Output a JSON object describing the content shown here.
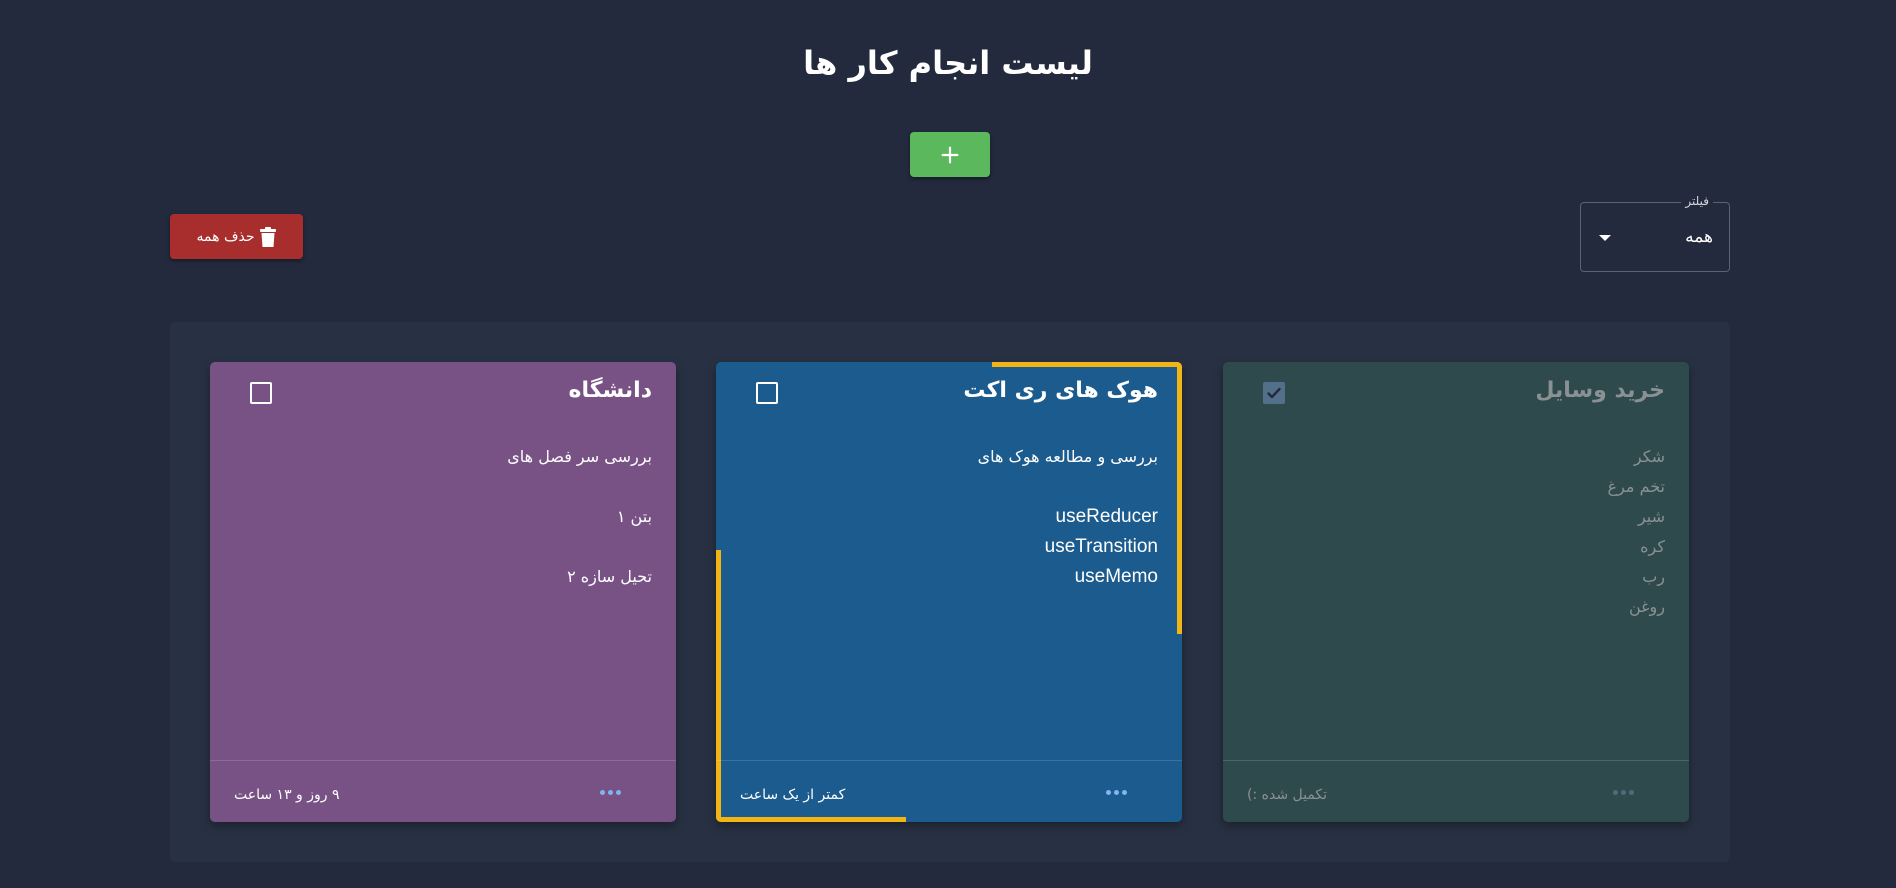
{
  "header": {
    "title": "لیست انجام کار ها",
    "add_icon": "plus-icon"
  },
  "filter": {
    "label": "فیلتر",
    "selected": "همه"
  },
  "toolbar": {
    "delete_all_label": "حذف همه",
    "delete_icon": "trash-icon"
  },
  "colors": {
    "background": "#232a3d",
    "board": "#283143",
    "add_button": "#5cb85c",
    "delete_button": "#a82d2d",
    "card_university": "#785285",
    "card_hooks": "#1b5b8e",
    "card_shopping": "#2f4a4c",
    "highlight": "#f3b416"
  },
  "cards": [
    {
      "title": "دانشگاه",
      "checked": false,
      "lines": [
        "بررسی سر فصل های",
        "",
        "بتن ۱",
        "",
        "تحیل سازه ۲"
      ],
      "footer": "۹ روز و ۱۳ ساعت"
    },
    {
      "title": "هوک های ری اکت",
      "checked": false,
      "lines": [
        "بررسی و مطالعه هوک های",
        "",
        "useReducer",
        "useTransition",
        "useMemo"
      ],
      "footer": "کمتر از یک ساعت"
    },
    {
      "title": "خرید وسایل",
      "checked": true,
      "lines": [
        "شکر",
        "تخم مرغ",
        "شیر",
        "کره",
        "رب",
        "روغن"
      ],
      "footer": "تکمیل شده :)"
    }
  ]
}
